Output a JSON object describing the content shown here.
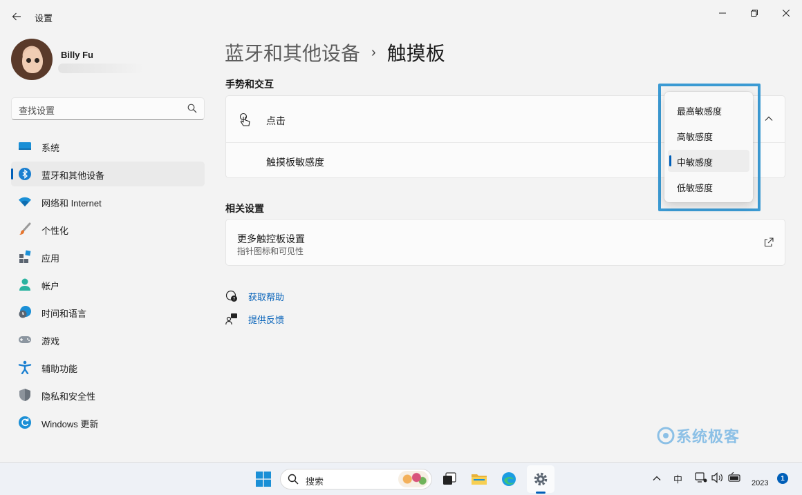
{
  "window": {
    "title": "设置",
    "back_icon": "arrow-left-icon",
    "controls": [
      "minimize-icon",
      "maximize-icon",
      "close-icon"
    ]
  },
  "profile": {
    "name": "Billy Fu",
    "email": ""
  },
  "search": {
    "placeholder": "查找设置",
    "icon": "search-icon"
  },
  "sidebar": {
    "items": [
      {
        "label": "系统",
        "icon": "monitor-icon",
        "active": false
      },
      {
        "label": "蓝牙和其他设备",
        "icon": "bluetooth-icon",
        "active": true
      },
      {
        "label": "网络和 Internet",
        "icon": "wifi-icon",
        "active": false
      },
      {
        "label": "个性化",
        "icon": "brush-icon",
        "active": false
      },
      {
        "label": "应用",
        "icon": "apps-icon",
        "active": false
      },
      {
        "label": "帐户",
        "icon": "person-icon",
        "active": false
      },
      {
        "label": "时间和语言",
        "icon": "globe-clock-icon",
        "active": false
      },
      {
        "label": "游戏",
        "icon": "gamepad-icon",
        "active": false
      },
      {
        "label": "辅助功能",
        "icon": "accessibility-icon",
        "active": false
      },
      {
        "label": "隐私和安全性",
        "icon": "shield-icon",
        "active": false
      },
      {
        "label": "Windows 更新",
        "icon": "update-icon",
        "active": false
      }
    ]
  },
  "main": {
    "breadcrumb": {
      "parent": "蓝牙和其他设备",
      "separator": "›",
      "current": "触摸板"
    },
    "gestures": {
      "section_title": "手势和交互",
      "tap_label": "点击",
      "sensitivity_label": "触摸板敏感度"
    },
    "related": {
      "section_title": "相关设置",
      "more_title": "更多触控板设置",
      "more_subtitle": "指针图标和可见性"
    },
    "help": {
      "get_help": "获取帮助",
      "feedback": "提供反馈"
    }
  },
  "dropdown": {
    "options": [
      "最高敏感度",
      "高敏感度",
      "中敏感度",
      "低敏感度"
    ],
    "selected": "中敏感度",
    "highlight_color": "#3b9ad3"
  },
  "watermark": {
    "text": "系统极客"
  },
  "taskbar": {
    "search_label": "搜索",
    "tray_ime": "中",
    "clock": "2023",
    "notification_count": "1",
    "apps": [
      "windows-start-icon",
      "task-view-icon",
      "file-explorer-icon",
      "edge-icon",
      "settings-icon"
    ]
  },
  "colors": {
    "accent": "#005fb8",
    "background": "#f3f3f3",
    "card": "#fbfbfb"
  }
}
